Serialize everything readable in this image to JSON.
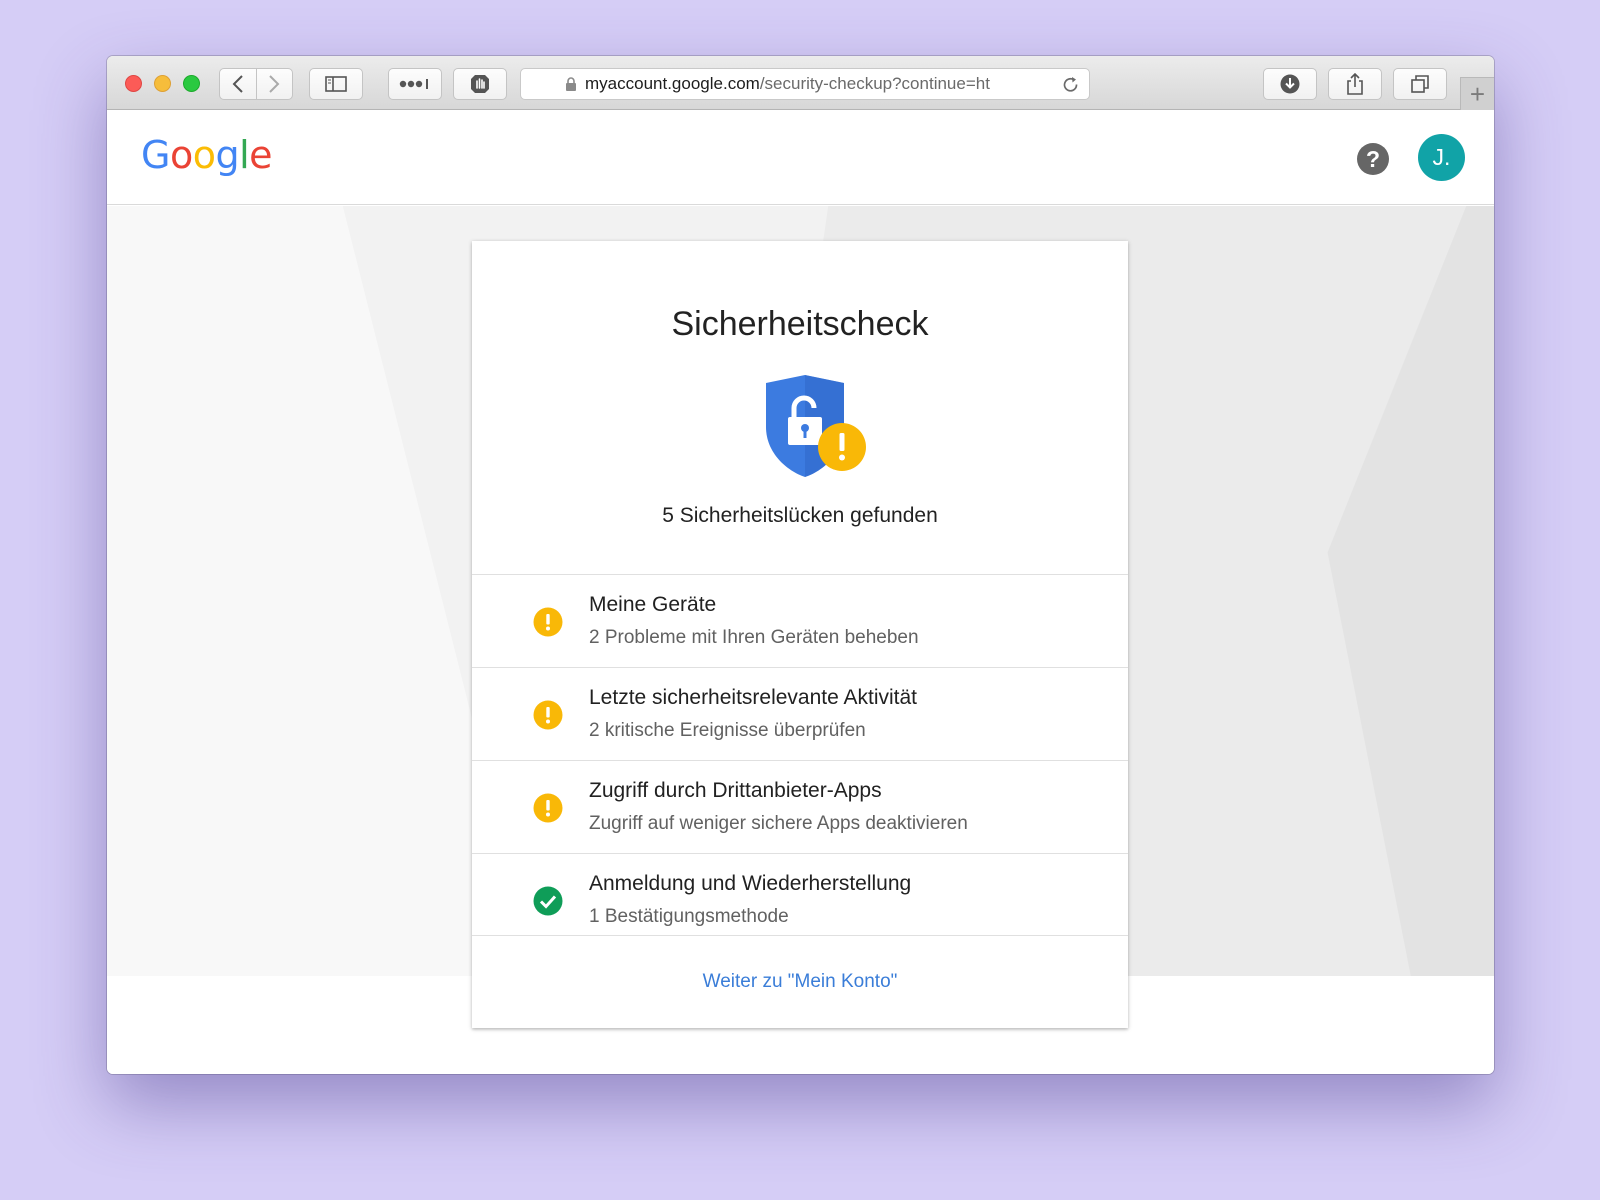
{
  "browser": {
    "url_host": "myaccount.google.com",
    "url_path": "/security-checkup?continue=ht",
    "new_tab_symbol": "+"
  },
  "header": {
    "logo_letters": [
      {
        "char": "G",
        "color": "#4285f4"
      },
      {
        "char": "o",
        "color": "#ea4335"
      },
      {
        "char": "o",
        "color": "#fbbc05"
      },
      {
        "char": "g",
        "color": "#4285f4"
      },
      {
        "char": "l",
        "color": "#34a853"
      },
      {
        "char": "e",
        "color": "#ea4335"
      }
    ],
    "help_symbol": "?",
    "avatar_initial": "J."
  },
  "card": {
    "title": "Sicherheitscheck",
    "summary": "5 Sicherheitslücken gefunden",
    "items": [
      {
        "title": "Meine Geräte",
        "subtitle": "2 Probleme mit Ihren Geräten beheben",
        "status": "warning"
      },
      {
        "title": "Letzte sicherheitsrelevante Aktivität",
        "subtitle": "2 kritische Ereignisse überprüfen",
        "status": "warning"
      },
      {
        "title": "Zugriff durch Drittanbieter-Apps",
        "subtitle": "Zugriff auf weniger sichere Apps deaktivieren",
        "status": "warning"
      },
      {
        "title": "Anmeldung und Wiederherstellung",
        "subtitle": "1 Bestätigungsmethode",
        "status": "ok"
      }
    ],
    "continue_link": "Weiter zu \"Mein Konto\""
  },
  "colors": {
    "warning": "#f9b807",
    "ok": "#0f9d58",
    "shield": "#3c7be0",
    "link": "#3a7dd8",
    "avatar": "#11a3a7",
    "background": "#d5cdf6"
  }
}
